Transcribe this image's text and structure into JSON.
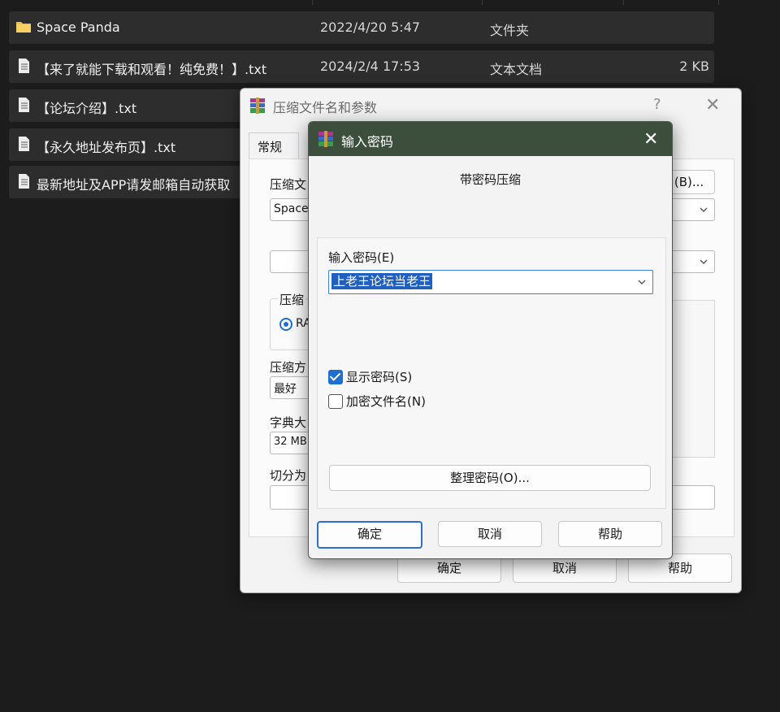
{
  "file_list": {
    "rows": [
      {
        "icon": "folder-icon",
        "name": "Space Panda",
        "date": "2022/4/20 5:47",
        "type": "文件夹",
        "size": ""
      },
      {
        "icon": "text-file-icon",
        "name": "【来了就能下载和观看！纯免费！】.txt",
        "date": "2024/2/4 17:53",
        "type": "文本文档",
        "size": "2 KB"
      },
      {
        "icon": "text-file-icon",
        "name": "【论坛介绍】.txt",
        "date": "",
        "type": "",
        "size": ""
      },
      {
        "icon": "text-file-icon",
        "name": "【永久地址发布页】.txt",
        "date": "",
        "type": "",
        "size": ""
      },
      {
        "icon": "text-file-icon",
        "name": "最新地址及APP请发邮箱自动获取",
        "date": "",
        "type": "",
        "size": ""
      }
    ]
  },
  "archive_dialog": {
    "title": "压缩文件名和参数",
    "help_glyph": "?",
    "close_glyph": "✕",
    "tab_general": "常规",
    "archive_name_label": "压缩文",
    "archive_name_value": "Space_",
    "browse_button": "(B)...",
    "format_label": "压缩",
    "format_option": "RA",
    "method_label": "压缩方",
    "method_value": "最好",
    "dict_label": "字典大",
    "dict_value": "32 MB",
    "split_label": "切分为",
    "ok": "确定",
    "cancel": "取消",
    "help": "帮助"
  },
  "password_dialog": {
    "title": "输入密码",
    "close_glyph": "✕",
    "heading": "带密码压缩",
    "password_label": "输入密码(E)",
    "password_value": "上老王论坛当老王",
    "show_password_label": "显示密码(S)",
    "show_password_checked": true,
    "encrypt_names_label": "加密文件名(N)",
    "encrypt_names_checked": false,
    "organize_button": "整理密码(O)...",
    "ok": "确定",
    "cancel": "取消",
    "help": "帮助"
  },
  "colors": {
    "background": "#1c1c1c",
    "row": "#2d2d2d",
    "folder": "#f2c14e",
    "password_titlebar": "#3c4f3d",
    "selection": "#1f5fbf",
    "accent": "#2f6fca"
  }
}
